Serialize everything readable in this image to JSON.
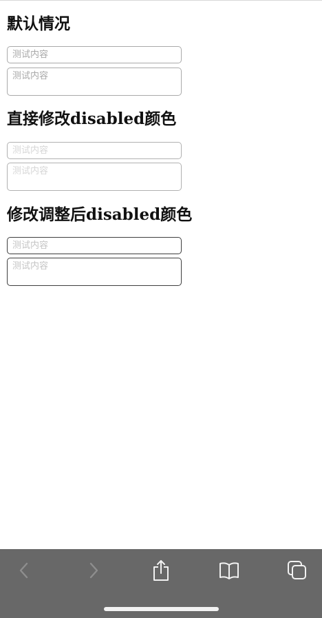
{
  "sections": [
    {
      "title": "默认情况",
      "input_placeholder": "测试内容",
      "textarea_placeholder": "测试内容"
    },
    {
      "title": "直接修改disabled颜色",
      "input_placeholder": "测试内容",
      "textarea_placeholder": "测试内容"
    },
    {
      "title": "修改调整后disabled颜色",
      "input_placeholder": "测试内容",
      "textarea_placeholder": "测试内容"
    }
  ],
  "toolbar": {
    "background": "#686868",
    "icons": [
      "back-icon",
      "forward-icon",
      "share-icon",
      "bookmarks-icon",
      "tabs-icon"
    ]
  }
}
